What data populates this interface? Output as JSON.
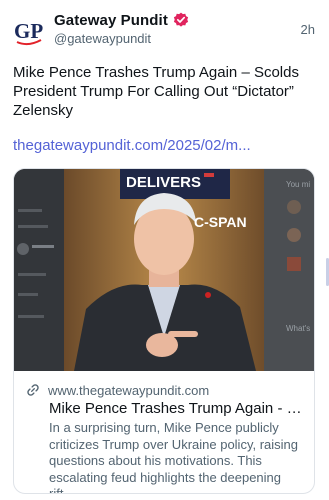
{
  "post": {
    "author": {
      "display_name": "Gateway Pundit",
      "handle": "@gatewaypundit",
      "avatar_text": "GP",
      "avatar_icon": "gateway-pundit-logo",
      "verified_icon": "verified-badge-icon",
      "verified_color": "#e0245e"
    },
    "time": "2h",
    "text": "Mike Pence Trashes Trump Again – Scolds\nPresident Trump For Calling Out “Dictator”\nZelensky",
    "link_text": "thegatewaypundit.com/2025/02/m...",
    "link_color": "#5563d6"
  },
  "card": {
    "image_overlay_top": "DELIVERS",
    "image_overlay_brand": "C-SPAN",
    "sidebar_label": "You mi",
    "sidebar_label_2": "What's",
    "domain_icon": "link-icon",
    "domain": "www.thegatewaypundit.com",
    "title": "Mike Pence Trashes Trump Again - Scolds President Trump For Calling Out “Dictator” Zelensky",
    "description": "In a surprising turn, Mike Pence publicly criticizes Trump over Ukraine policy, raising questions about his motivations. This escalating feud highlights the deepening rift..."
  }
}
